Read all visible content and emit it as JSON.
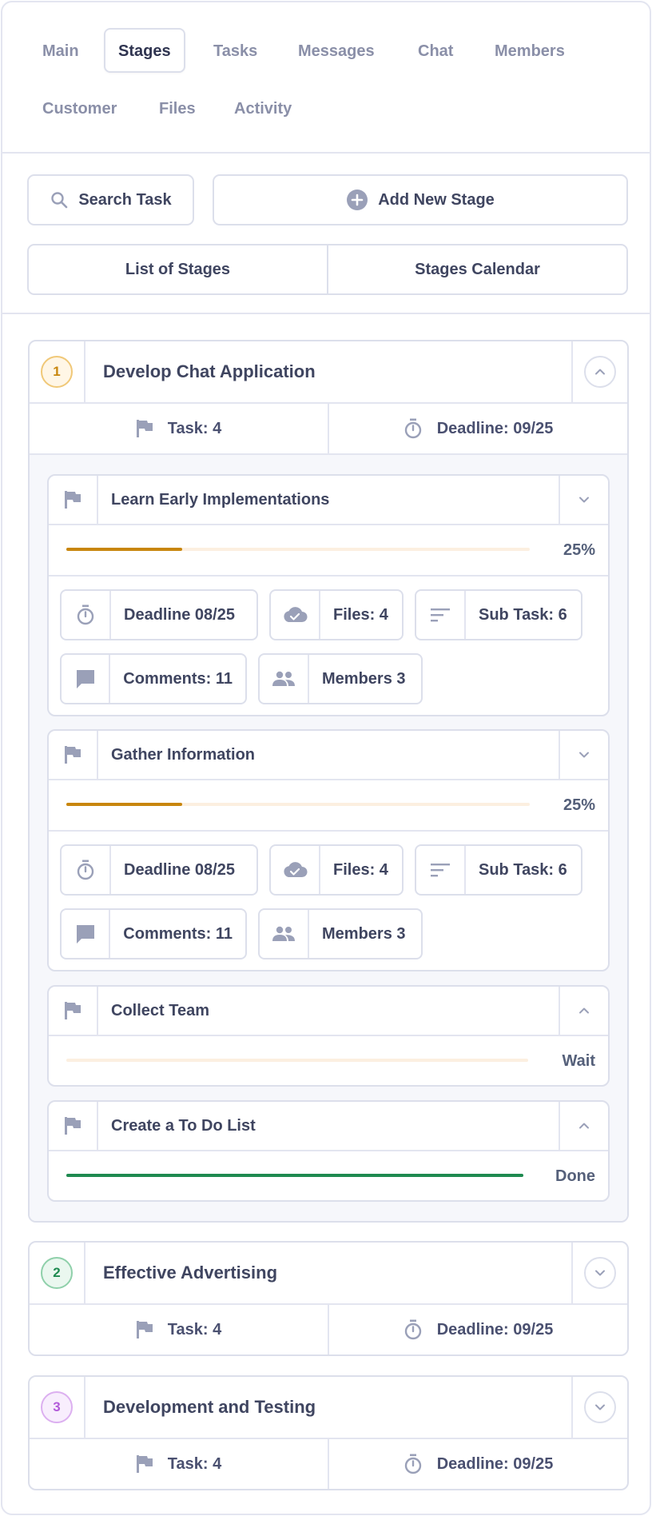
{
  "tabs": [
    {
      "label": "Main"
    },
    {
      "label": "Stages",
      "active": true
    },
    {
      "label": "Tasks"
    },
    {
      "label": "Messages"
    },
    {
      "label": "Chat"
    },
    {
      "label": "Members"
    },
    {
      "label": "Customer"
    },
    {
      "label": "Files"
    },
    {
      "label": "Activity"
    }
  ],
  "toolbar": {
    "search_label": "Search Task",
    "add_stage_label": "Add New Stage",
    "view_list_label": "List of Stages",
    "view_calendar_label": "Stages Calendar"
  },
  "colors": {
    "orange": "#c8860d",
    "green": "#1f8a50",
    "purple": "#b25ad9",
    "icon": "#9aa0b8"
  },
  "stages": [
    {
      "number": "1",
      "title": "Develop Chat Application",
      "task_count": "Task: 4",
      "deadline": "Deadline: 09/25",
      "expanded": true,
      "tasks": [
        {
          "title": "Learn Early Implementations",
          "progress": 0.25,
          "status": "25%",
          "chips": {
            "deadline": "Deadline 08/25",
            "files": "Files: 4",
            "subtasks": "Sub Task: 6",
            "comments": "Comments: 11",
            "members": "Members 3"
          }
        },
        {
          "title": "Gather Information",
          "progress": 0.25,
          "status": "25%",
          "chips": {
            "deadline": "Deadline 08/25",
            "files": "Files: 4",
            "subtasks": "Sub Task: 6",
            "comments": "Comments: 11",
            "members": "Members 3"
          }
        },
        {
          "title": "Collect Team",
          "progress": 0,
          "status": "Wait"
        },
        {
          "title": "Create a To Do List",
          "progress": 1,
          "status": "Done"
        }
      ]
    },
    {
      "number": "2",
      "title": "Effective Advertising",
      "task_count": "Task: 4",
      "deadline": "Deadline: 09/25"
    },
    {
      "number": "3",
      "title": "Development and Testing",
      "task_count": "Task: 4",
      "deadline": "Deadline: 09/25"
    }
  ]
}
